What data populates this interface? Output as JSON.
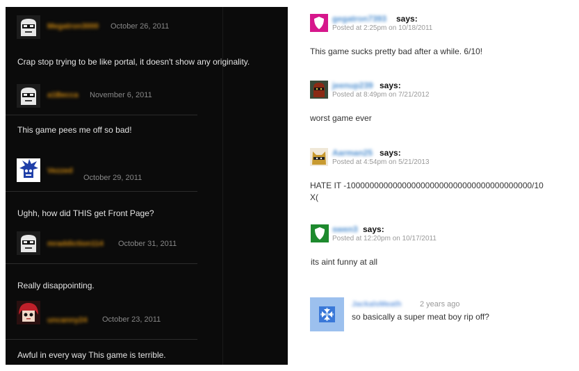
{
  "left_comments": [
    {
      "username": "Megatron3000",
      "date": "October 26, 2011",
      "text": "Crap   stop trying to be like portal, it doesn't show any originality.",
      "avatar": "white-face-avatar-icon"
    },
    {
      "username": "a1Becca",
      "date": "November 6, 2011",
      "text": "This game pees me off so bad!",
      "avatar": "white-face-avatar-icon"
    },
    {
      "username": "Vezzed",
      "date": "October 29, 2011",
      "text": "Ughh, how did THIS get Front Page?",
      "avatar": "blue-spiky-avatar-icon"
    },
    {
      "username": "mraddiction114",
      "date": "October 31, 2011",
      "text": "Really disappointing.",
      "avatar": "white-face-avatar-icon"
    },
    {
      "username": "uncanny24",
      "date": "October 23, 2011",
      "text": "Awful in every way This game is terrible.",
      "avatar": "red-hair-avatar-icon"
    }
  ],
  "right_comments": [
    {
      "username": "gegatron7393",
      "says": "says:",
      "posted": "Posted at 2:25pm on 10/18/2011",
      "text": "This game sucks pretty bad after a while. 6/10!",
      "avatar": "pink-shield-avatar-icon"
    },
    {
      "username": "jeenup239",
      "says": "says:",
      "posted": "Posted at 8:49pm on 7/21/2012",
      "text": "worst game ever",
      "avatar": "masked-face-avatar-icon"
    },
    {
      "username": "Aarman25",
      "says": "says:",
      "posted": "Posted at 4:54pm on 5/21/2013",
      "text": "HATE IT -1000000000000000000000000000000000000000/10\nX(",
      "avatar": "cat-ninja-avatar-icon"
    },
    {
      "username": "swen3",
      "says": "says:",
      "posted": "Posted at 12:20pm on 10/17/2011",
      "text": "its aint funny at all",
      "avatar": "green-shield-avatar-icon"
    }
  ],
  "youtube_comment": {
    "username": "JackalsMeath",
    "age": "2 years ago",
    "text": "so basically a super meat boy rip off?",
    "avatar": "default-blue-avatar-icon"
  },
  "colors": {
    "dark_bg": "#0b0b0b",
    "username_orange": "#d08a10",
    "link_blue": "#4c8ed0"
  }
}
